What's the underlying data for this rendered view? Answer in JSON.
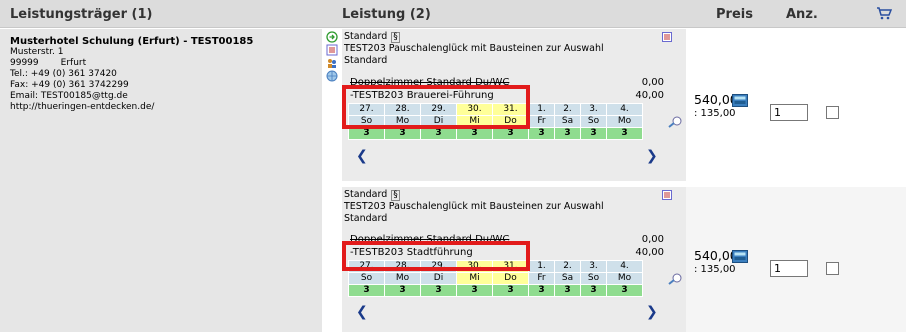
{
  "header": {
    "provider": "Leistungsträger (1)",
    "service": "Leistung (2)",
    "price": "Preis",
    "qty": "Anz."
  },
  "provider": {
    "name": "Musterhotel Schulung (Erfurt) - TEST00185",
    "street": "Musterstr. 1",
    "zip": "99999",
    "city": "Erfurt",
    "tel": "Tel.: +49 (0) 361 37420",
    "fax": "Fax: +49 (0) 361 3742299",
    "email": "Email: TEST00185@ttg.de",
    "web": "http://thueringen-entdecken.de/"
  },
  "services": [
    {
      "category": "Standard",
      "para": "§",
      "title": "TEST203 Pauschalenglück mit Bausteinen zur Auswahl",
      "rate": "Standard",
      "items": [
        {
          "label": "Doppelzimmer Standard Du/WC",
          "amount": "0,00"
        },
        {
          "label": "-TESTB203 Brauerei-Führung",
          "amount": "40,00"
        }
      ],
      "days": [
        {
          "num": "27.",
          "wd": "So"
        },
        {
          "num": "28.",
          "wd": "Mo"
        },
        {
          "num": "29.",
          "wd": "Di"
        },
        {
          "num": "30.",
          "wd": "Mi"
        },
        {
          "num": "31.",
          "wd": "Do"
        },
        {
          "num": "1.",
          "wd": "Fr"
        },
        {
          "num": "2.",
          "wd": "Sa"
        },
        {
          "num": "3.",
          "wd": "So"
        },
        {
          "num": "4.",
          "wd": "Mo"
        }
      ],
      "counts": [
        "3",
        "3",
        "3",
        "3",
        "3",
        "3",
        "3",
        "3",
        "3"
      ],
      "price": "540,00",
      "unit_price": ": 135,00",
      "quantity": "1",
      "checked": false
    },
    {
      "category": "Standard",
      "para": "§",
      "title": "TEST203 Pauschalenglück mit Bausteinen zur Auswahl",
      "rate": "Standard",
      "items": [
        {
          "label": "Doppelzimmer Standard Du/WC",
          "amount": "0,00"
        },
        {
          "label": "-TESTB203 Stadtführung",
          "amount": "40,00"
        }
      ],
      "days": [
        {
          "num": "27.",
          "wd": "So"
        },
        {
          "num": "28.",
          "wd": "Mo"
        },
        {
          "num": "29.",
          "wd": "Di"
        },
        {
          "num": "30.",
          "wd": "Mi"
        },
        {
          "num": "31.",
          "wd": "Do"
        },
        {
          "num": "1.",
          "wd": "Fr"
        },
        {
          "num": "2.",
          "wd": "Sa"
        },
        {
          "num": "3.",
          "wd": "So"
        },
        {
          "num": "4.",
          "wd": "Mo"
        }
      ],
      "counts": [
        "3",
        "3",
        "3",
        "3",
        "3",
        "3",
        "3",
        "3",
        "3"
      ],
      "price": "540,00",
      "unit_price": ": 135,00",
      "quantity": "1",
      "checked": false
    }
  ],
  "icons": [
    "arrow-circle-icon",
    "flag-list-icon",
    "people-icon",
    "globe-icon",
    "calculator-icon",
    "cart-icon",
    "select-date-icon"
  ],
  "colors": {
    "header_bg": "#dcdcdc",
    "day_cell": "#cfe0ea",
    "day_highlight": "#ffff99",
    "count_cell": "#8fdc8f",
    "highlight_box": "#e21b1b",
    "nav_arrow": "#1a3a8a"
  }
}
